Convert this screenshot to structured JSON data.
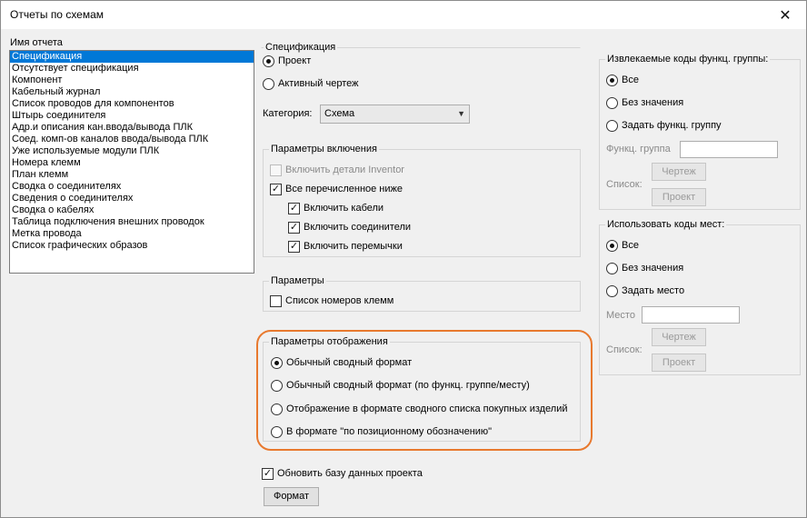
{
  "window": {
    "title": "Отчеты по схемам",
    "close_glyph": "✕"
  },
  "report_list": {
    "label": "Имя отчета",
    "items": [
      "Спецификация",
      "Отсутствует спецификация",
      "Компонент",
      "Кабельный журнал",
      "Список проводов для компонентов",
      "Штырь соединителя",
      "Адр.и описания кан.ввода/вывода ПЛК",
      "Соед. комп-ов каналов ввода/вывода ПЛК",
      "Уже используемые модули ПЛК",
      "Номера клемм",
      "План клемм",
      "Сводка о соединителях",
      "Сведения о соединителях",
      "Сводка о кабелях",
      "Таблица подключения внешних проводок",
      "Метка провода",
      "Список графических образов"
    ],
    "selected_index": 0
  },
  "spec": {
    "group_title": "Спецификация",
    "radio_project": "Проект",
    "radio_active": "Активный чертеж",
    "category_label": "Категория:",
    "category_value": "Схема"
  },
  "inclusion": {
    "title": "Параметры включения",
    "inventor": "Включить детали Inventor",
    "all_listed": "Все перечисленное ниже",
    "cables": "Включить кабели",
    "connectors": "Включить соединители",
    "jumpers": "Включить перемычки"
  },
  "params": {
    "title": "Параметры",
    "terminal_list": "Список номеров клемм"
  },
  "display": {
    "title": "Параметры отображения",
    "opt1": "Обычный сводный формат",
    "opt2": "Обычный сводный формат (по функц. группе/месту)",
    "opt3": "Отображение в формате сводного списка покупных изделий",
    "opt4": "В формате \"по позиционному обозначению\""
  },
  "update_db": "Обновить базу данных проекта",
  "format_button": "Формат",
  "func_group": {
    "title": "Извлекаемые коды функц. группы:",
    "all": "Все",
    "none": "Без значения",
    "set": "Задать функц. группу",
    "field_label": "Функц. группа",
    "drawing_btn": "Чертеж",
    "list_label": "Список:",
    "project_btn": "Проект"
  },
  "location": {
    "title": "Использовать коды мест:",
    "all": "Все",
    "none": "Без значения",
    "set": "Задать место",
    "field_label": "Место",
    "drawing_btn": "Чертеж",
    "list_label": "Список:",
    "project_btn": "Проект"
  },
  "colors": {
    "accent": "#0078d7",
    "highlight": "#e8792e"
  }
}
